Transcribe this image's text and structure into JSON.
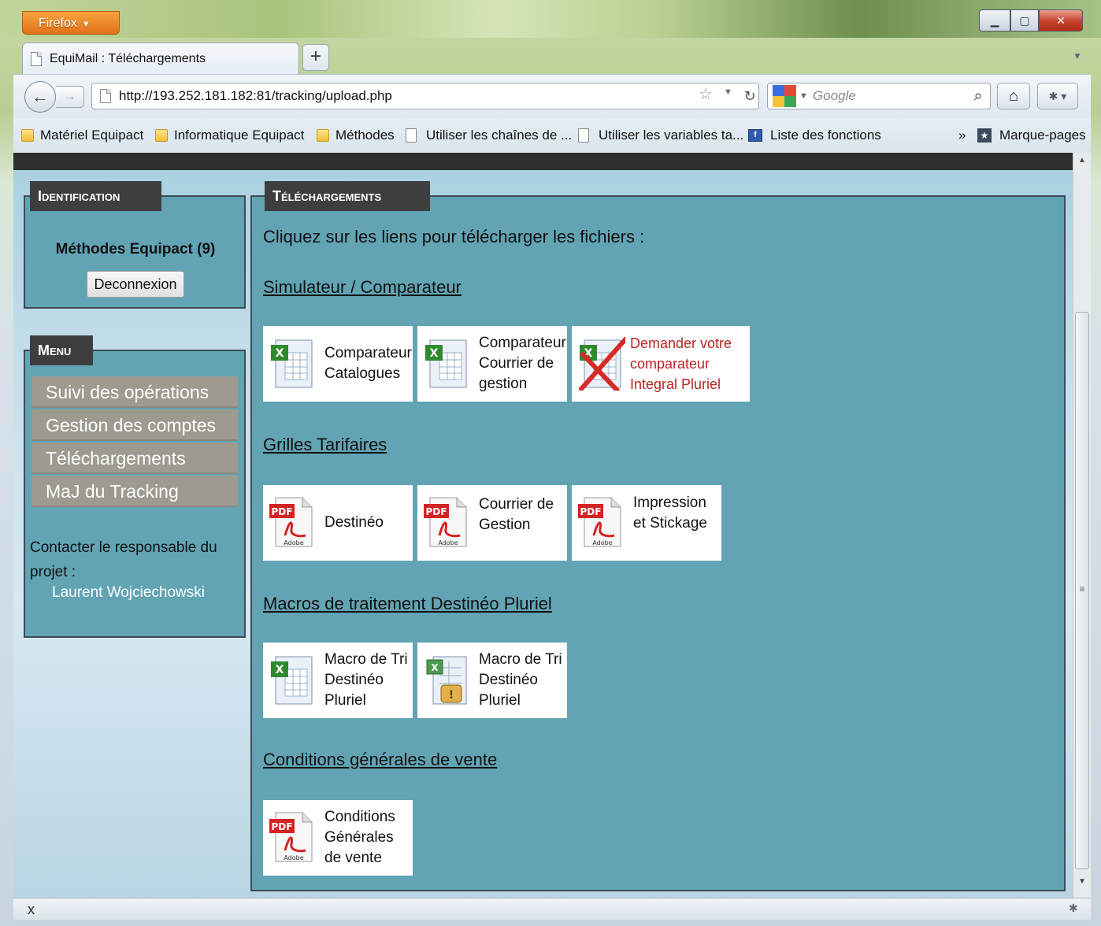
{
  "browser": {
    "menu_button": "Firefox",
    "tab_title": "EquiMail : Téléchargements",
    "new_tab": "+",
    "url": "http://193.252.181.182:81/tracking/upload.php",
    "search_placeholder": "Google",
    "bookmarks": [
      {
        "label": "Matériel Equipact",
        "icon": "folder-icon"
      },
      {
        "label": "Informatique Equipact",
        "icon": "folder-icon"
      },
      {
        "label": "Méthodes",
        "icon": "folder-icon"
      },
      {
        "label": "Utiliser les chaînes de ...",
        "icon": "page-icon"
      },
      {
        "label": "Utiliser les variables ta...",
        "icon": "page-icon"
      },
      {
        "label": "Liste des fonctions",
        "icon": "function-list-icon"
      }
    ],
    "bookmarks_overflow": "»",
    "bookmarks_menu": "Marque-pages",
    "status_close": "x"
  },
  "identification": {
    "title": "Identification",
    "user": "Méthodes Equipact (9)",
    "logout_button": "Deconnexion"
  },
  "menu": {
    "title": "Menu",
    "items": [
      "Suivi des opérations",
      "Gestion des comptes",
      "Téléchargements",
      "MaJ du Tracking"
    ],
    "contact_label": "Contacter le responsable du projet :",
    "contact_name": "Laurent Wojciechowski"
  },
  "downloads": {
    "title": "Téléchargements",
    "intro": "Cliquez sur les liens pour télécharger les fichiers :",
    "sections": [
      {
        "title": "Simulateur / Comparateur",
        "files": [
          {
            "label": "Comparateur Catalogues",
            "icon": "excel-file-icon"
          },
          {
            "label": "Comparateur Courrier de gestion",
            "icon": "excel-file-icon"
          },
          {
            "label": "Demander votre comparateur Integral Pluriel",
            "icon": "excel-file-crossed-icon"
          }
        ]
      },
      {
        "title": "Grilles Tarifaires",
        "files": [
          {
            "label": "Destinéo",
            "icon": "pdf-file-icon"
          },
          {
            "label": "Courrier de Gestion",
            "icon": "pdf-file-icon"
          },
          {
            "label": "Impression et Stickage",
            "icon": "pdf-file-icon"
          }
        ]
      },
      {
        "title": "Macros de traitement Destinéo Pluriel",
        "files": [
          {
            "label": "Macro de Tri Destinéo Pluriel",
            "icon": "excel-file-icon"
          },
          {
            "label": "Macro de Tri Destinéo Pluriel",
            "icon": "excel-macro-file-icon"
          }
        ]
      },
      {
        "title": "Conditions générales de vente",
        "files": [
          {
            "label": "Conditions Générales de vente",
            "icon": "pdf-file-icon"
          }
        ]
      }
    ]
  },
  "colors": {
    "panel_bg": "#62a4b4",
    "panel_tab_bg": "#3e3e3e",
    "menu_item_bg": "#9f9a90",
    "disabled_link": "#bb2222"
  }
}
